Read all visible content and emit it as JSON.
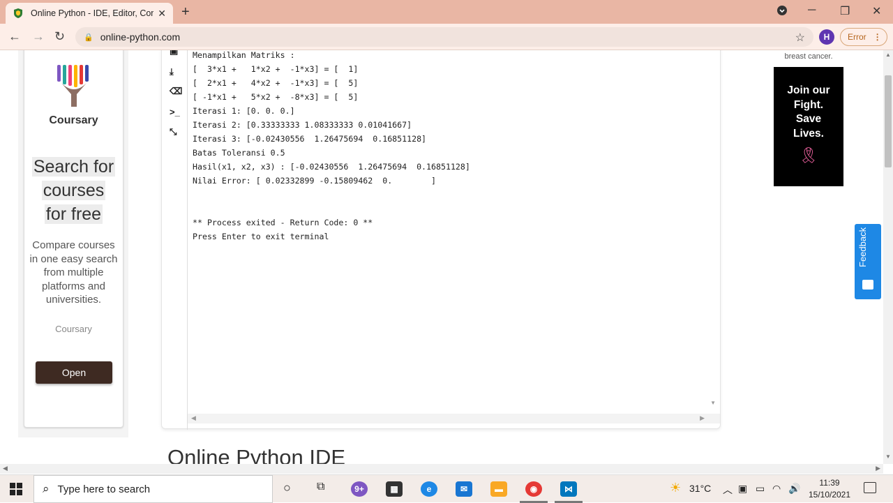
{
  "browser": {
    "tab_title": "Online Python - IDE, Editor, Comp",
    "new_tab": "+",
    "url": "online-python.com",
    "profile_initial": "H",
    "error_label": "Error",
    "accent": "#e9b6a4"
  },
  "left_ad": {
    "brand": "Coursary",
    "headline_1": "Search for",
    "headline_2": "courses",
    "headline_3": "for free",
    "description": "Compare courses in one easy search from multiple platforms and universities.",
    "brand_footer": "Coursary",
    "open_label": "Open"
  },
  "terminal": {
    "lines": [
      "Menampilkan Matriks :",
      "[  3*x1 +   1*x2 +  -1*x3] = [  1]",
      "[  2*x1 +   4*x2 +  -1*x3] = [  5]",
      "[ -1*x1 +   5*x2 +  -8*x3] = [  5]",
      "Iterasi 1: [0. 0. 0.]",
      "Iterasi 2: [0.33333333 1.08333333 0.01041667]",
      "Iterasi 3: [-0.02430556  1.26475694  0.16851128]",
      "Batas Toleransi 0.5",
      "Hasil(x1, x2, x3) : [-0.02430556  1.26475694  0.16851128]",
      "Nilai Error: [ 0.02332899 -0.15809462  0.        ]",
      "",
      "",
      "** Process exited - Return Code: 0 **",
      "Press Enter to exit terminal"
    ]
  },
  "right_ad": {
    "top_text": "breast cancer.",
    "slogan_1": "Join our",
    "slogan_2": "Fight.",
    "slogan_3": "Save",
    "slogan_4": "Lives."
  },
  "feedback_label": "Feedback",
  "section_title": "Online Python IDE",
  "taskbar": {
    "search_placeholder": "Type here to search",
    "temperature": "31°C",
    "time": "11:39",
    "date": "15/10/2021"
  }
}
